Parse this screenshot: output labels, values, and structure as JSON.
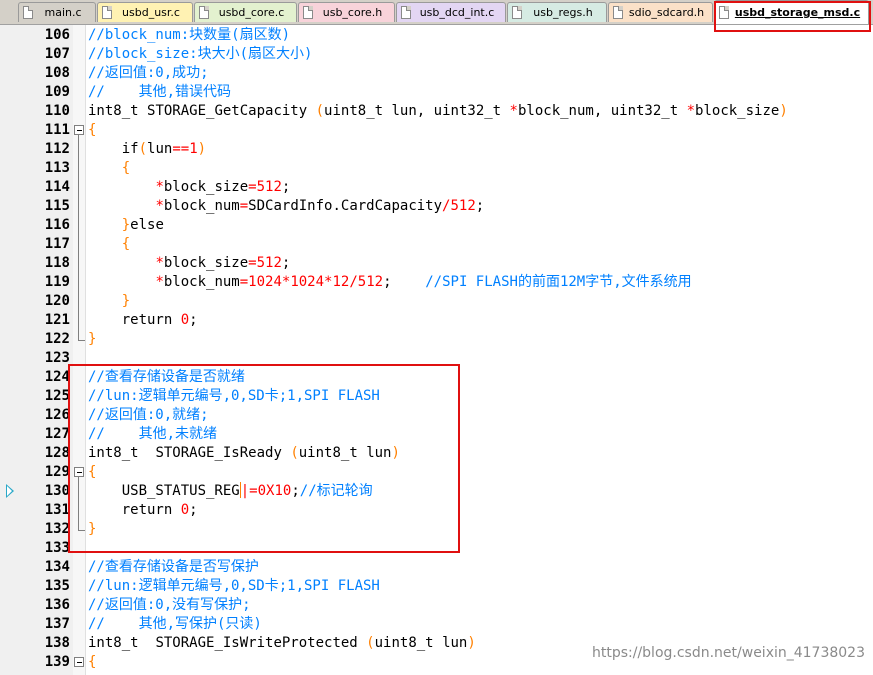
{
  "tabs": [
    {
      "label": "main.c",
      "color": "#d4d0c8"
    },
    {
      "label": "usbd_usr.c",
      "color": "#fff2b3"
    },
    {
      "label": "usbd_core.c",
      "color": "#e3f1cf"
    },
    {
      "label": "usb_core.h",
      "color": "#f8d3da"
    },
    {
      "label": "usb_dcd_int.c",
      "color": "#e3d6f3"
    },
    {
      "label": "usb_regs.h",
      "color": "#d6ebe3"
    },
    {
      "label": "sdio_sdcard.h",
      "color": "#fbe1c8"
    },
    {
      "label": "usbd_storage_msd.c",
      "color": "#ffffff",
      "active": true
    }
  ],
  "lines": [
    {
      "n": "106",
      "t": "//block_num:块数量(扇区数)"
    },
    {
      "n": "107",
      "t": "//block_size:块大小(扇区大小)"
    },
    {
      "n": "108",
      "t": "//返回值:0,成功;"
    },
    {
      "n": "109",
      "t": "//    其他,错误代码"
    },
    {
      "n": "110",
      "t": "int8_t STORAGE_GetCapacity (uint8_t lun, uint32_t *block_num, uint32_t *block_size)"
    },
    {
      "n": "111",
      "t": "{"
    },
    {
      "n": "112",
      "t": "    if(lun==1)"
    },
    {
      "n": "113",
      "t": "    {"
    },
    {
      "n": "114",
      "t": "        *block_size=512;"
    },
    {
      "n": "115",
      "t": "        *block_num=SDCardInfo.CardCapacity/512;"
    },
    {
      "n": "116",
      "t": "    }else"
    },
    {
      "n": "117",
      "t": "    {"
    },
    {
      "n": "118",
      "t": "        *block_size=512;"
    },
    {
      "n": "119",
      "t": "        *block_num=1024*1024*12/512;    //SPI FLASH的前面12M字节,文件系统用"
    },
    {
      "n": "120",
      "t": "    }"
    },
    {
      "n": "121",
      "t": "    return 0;"
    },
    {
      "n": "122",
      "t": "}"
    },
    {
      "n": "123",
      "t": ""
    },
    {
      "n": "124",
      "t": "//查看存储设备是否就绪"
    },
    {
      "n": "125",
      "t": "//lun:逻辑单元编号,0,SD卡;1,SPI FLASH"
    },
    {
      "n": "126",
      "t": "//返回值:0,就绪;"
    },
    {
      "n": "127",
      "t": "//    其他,未就绪"
    },
    {
      "n": "128",
      "t": "int8_t  STORAGE_IsReady (uint8_t lun)"
    },
    {
      "n": "129",
      "t": "{"
    },
    {
      "n": "130",
      "t": "    USB_STATUS_REG|=0X10;//标记轮询"
    },
    {
      "n": "131",
      "t": "    return 0;"
    },
    {
      "n": "132",
      "t": "}"
    },
    {
      "n": "133",
      "t": ""
    },
    {
      "n": "134",
      "t": "//查看存储设备是否写保护"
    },
    {
      "n": "135",
      "t": "//lun:逻辑单元编号,0,SD卡;1,SPI FLASH"
    },
    {
      "n": "136",
      "t": "//返回值:0,没有写保护;"
    },
    {
      "n": "137",
      "t": "//    其他,写保护(只读)"
    },
    {
      "n": "138",
      "t": "int8_t  STORAGE_IsWriteProtected (uint8_t lun)"
    },
    {
      "n": "139",
      "t": "{"
    }
  ],
  "watermark": "https://blog.csdn.net/weixin_41738023",
  "colors": {
    "comment": "#0080ff",
    "number": "#ff0000",
    "operator": "#ff8000",
    "highlight": "#e01010"
  }
}
